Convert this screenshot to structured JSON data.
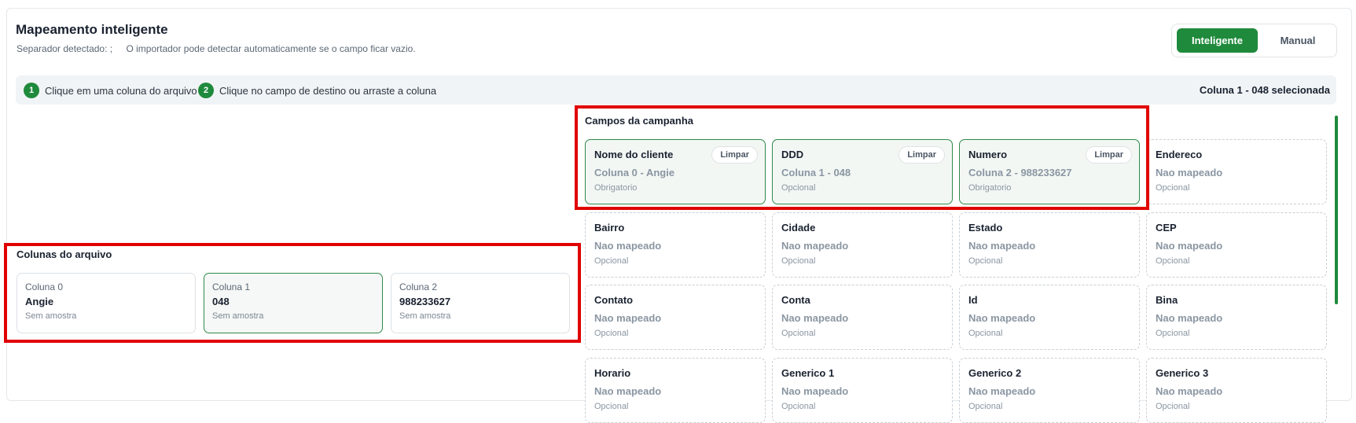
{
  "header": {
    "title": "Mapeamento inteligente",
    "separator_text": "Separador detectado: ;",
    "hint": "O importador pode detectar automaticamente se o campo ficar vazio."
  },
  "mode_toggle": {
    "active": "Inteligente",
    "inactive": "Manual"
  },
  "steps": {
    "step1_num": "1",
    "step1_text": "Clique em uma coluna do arquivo",
    "step2_num": "2",
    "step2_text": "Clique no campo de destino ou arraste a coluna",
    "selected_text": "Coluna 1 - 048 selecionada"
  },
  "file_columns": {
    "title": "Colunas do arquivo",
    "items": [
      {
        "name": "Coluna 0",
        "value": "Angie",
        "sample": "Sem amostra"
      },
      {
        "name": "Coluna 1",
        "value": "048",
        "sample": "Sem amostra"
      },
      {
        "name": "Coluna 2",
        "value": "988233627",
        "sample": "Sem amostra"
      }
    ]
  },
  "campaign_fields": {
    "title": "Campos da campanha",
    "clear_label": "Limpar",
    "items": [
      {
        "name": "Nome do cliente",
        "mapping": "Coluna 0 - Angie",
        "status": "Obrigatorio"
      },
      {
        "name": "DDD",
        "mapping": "Coluna 1 - 048",
        "status": "Opcional"
      },
      {
        "name": "Numero",
        "mapping": "Coluna 2 - 988233627",
        "status": "Obrigatorio"
      },
      {
        "name": "Endereco",
        "mapping": "Nao mapeado",
        "status": "Opcional"
      },
      {
        "name": "Bairro",
        "mapping": "Nao mapeado",
        "status": "Opcional"
      },
      {
        "name": "Cidade",
        "mapping": "Nao mapeado",
        "status": "Opcional"
      },
      {
        "name": "Estado",
        "mapping": "Nao mapeado",
        "status": "Opcional"
      },
      {
        "name": "CEP",
        "mapping": "Nao mapeado",
        "status": "Opcional"
      },
      {
        "name": "Contato",
        "mapping": "Nao mapeado",
        "status": "Opcional"
      },
      {
        "name": "Conta",
        "mapping": "Nao mapeado",
        "status": "Opcional"
      },
      {
        "name": "Id",
        "mapping": "Nao mapeado",
        "status": "Opcional"
      },
      {
        "name": "Bina",
        "mapping": "Nao mapeado",
        "status": "Opcional"
      },
      {
        "name": "Horario",
        "mapping": "Nao mapeado",
        "status": "Opcional"
      },
      {
        "name": "Generico 1",
        "mapping": "Nao mapeado",
        "status": "Opcional"
      },
      {
        "name": "Generico 2",
        "mapping": "Nao mapeado",
        "status": "Opcional"
      },
      {
        "name": "Generico 3",
        "mapping": "Nao mapeado",
        "status": "Opcional"
      }
    ]
  },
  "colors": {
    "accent": "#1f8a3c",
    "highlight": "#e00000"
  }
}
